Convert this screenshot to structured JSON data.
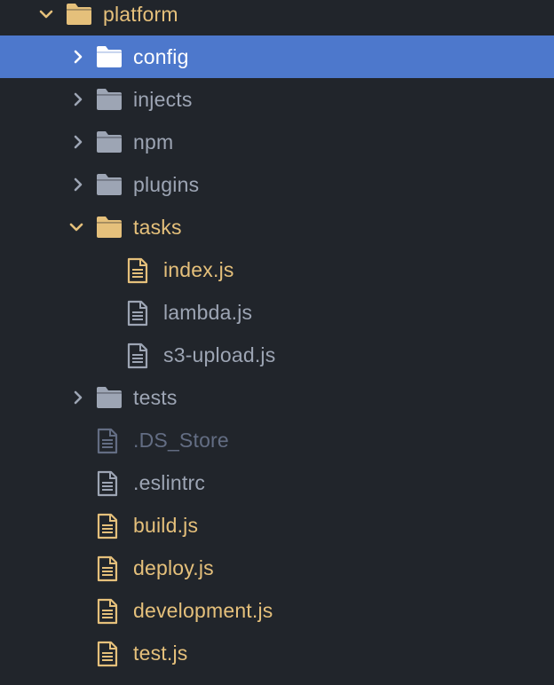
{
  "tree": {
    "root": {
      "label": "platform",
      "expanded": true,
      "icon": "folder-icon",
      "status": "modified"
    },
    "folders": [
      {
        "key": "config",
        "label": "config",
        "expanded": false,
        "selected": true,
        "icon": "folder-icon"
      },
      {
        "key": "injects",
        "label": "injects",
        "expanded": false,
        "selected": false,
        "icon": "folder-icon"
      },
      {
        "key": "npm",
        "label": "npm",
        "expanded": false,
        "selected": false,
        "icon": "folder-icon"
      },
      {
        "key": "plugins",
        "label": "plugins",
        "expanded": false,
        "selected": false,
        "icon": "folder-icon"
      },
      {
        "key": "tasks",
        "label": "tasks",
        "expanded": true,
        "selected": false,
        "icon": "folder-icon",
        "status": "modified",
        "children": [
          {
            "label": "index.js",
            "icon": "file-text-icon",
            "status": "modified"
          },
          {
            "label": "lambda.js",
            "icon": "file-text-icon",
            "status": "default"
          },
          {
            "label": "s3-upload.js",
            "icon": "file-text-icon",
            "status": "default"
          }
        ]
      },
      {
        "key": "tests",
        "label": "tests",
        "expanded": false,
        "selected": false,
        "icon": "folder-icon"
      }
    ],
    "files": [
      {
        "label": ".DS_Store",
        "icon": "file-text-icon",
        "status": "ignored"
      },
      {
        "label": ".eslintrc",
        "icon": "file-text-icon",
        "status": "default"
      },
      {
        "label": "build.js",
        "icon": "file-text-icon",
        "status": "modified"
      },
      {
        "label": "deploy.js",
        "icon": "file-text-icon",
        "status": "modified"
      },
      {
        "label": "development.js",
        "icon": "file-text-icon",
        "status": "modified"
      },
      {
        "label": "test.js",
        "icon": "file-text-icon",
        "status": "modified"
      }
    ]
  },
  "colors": {
    "background": "#21252b",
    "selection": "#4d78cc",
    "text_default": "#9da5b4",
    "text_modified": "#e5c07b",
    "text_selected": "#ffffff",
    "text_ignored": "#636d83"
  }
}
